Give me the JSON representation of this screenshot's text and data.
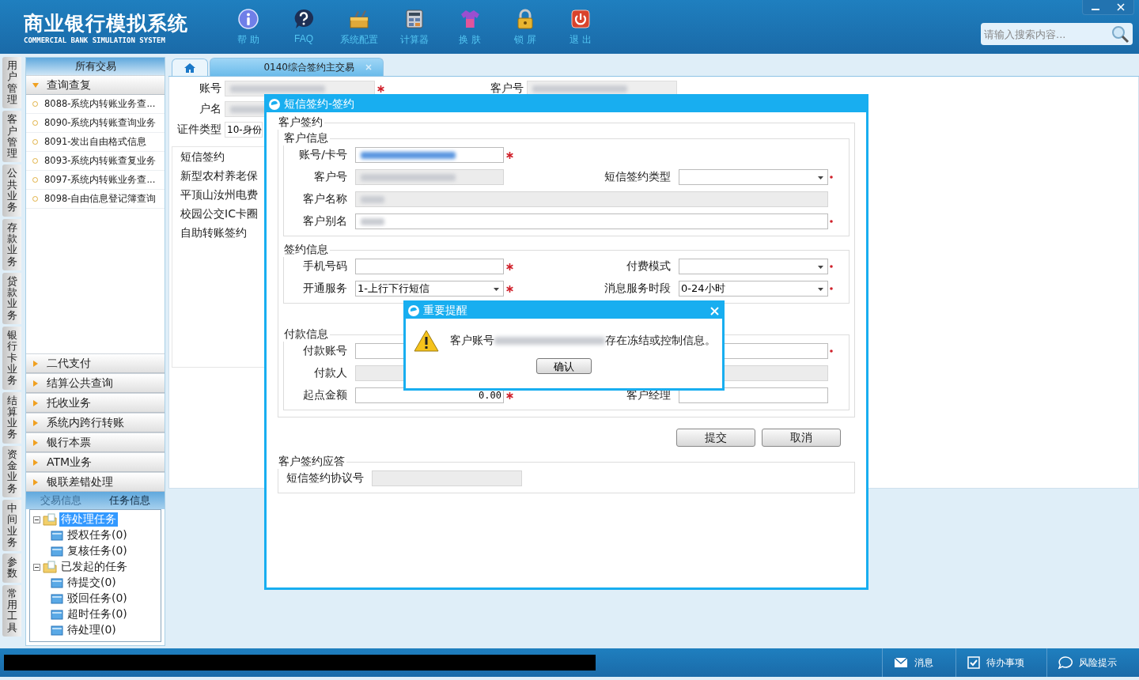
{
  "header": {
    "title": "商业银行模拟系统",
    "subtitle": "COMMERCIAL BANK SIMULATION SYSTEM",
    "toolbar": [
      {
        "kind": "info",
        "label": "帮 助"
      },
      {
        "kind": "faq",
        "label": "FAQ"
      },
      {
        "kind": "config",
        "label": "系统配置"
      },
      {
        "kind": "calculator",
        "label": "计算器"
      },
      {
        "kind": "skin",
        "label": "换 肤"
      },
      {
        "kind": "lock",
        "label": "锁 屏"
      },
      {
        "kind": "exit",
        "label": "退 出"
      }
    ],
    "search": {
      "placeholder": "请输入搜索内容..."
    }
  },
  "side_tabs": [
    "用户管理",
    "客户管理",
    "公共业务",
    "存款业务",
    "贷款业务",
    "银行卡业务",
    "结算业务",
    "资金业务",
    "中间业务",
    "参数",
    "常用工具"
  ],
  "sidebar": {
    "title": "所有交易",
    "groups": [
      {
        "label": "查询查复",
        "expanded": true,
        "items": [
          "8088-系统内转账业务查...",
          "8090-系统内转账查询业务",
          "8091-发出自由格式信息",
          "8093-系统内转账查复业务",
          "8097-系统内转账业务查...",
          "8098-自由信息登记簿查询"
        ]
      },
      {
        "label": "二代支付",
        "expanded": false
      },
      {
        "label": "结算公共查询",
        "expanded": false
      },
      {
        "label": "托收业务",
        "expanded": false
      },
      {
        "label": "系统内跨行转账",
        "expanded": false
      },
      {
        "label": "银行本票",
        "expanded": false
      },
      {
        "label": "ATM业务",
        "expanded": false
      },
      {
        "label": "银联差错处理",
        "expanded": false
      }
    ]
  },
  "task_panel": {
    "tabs": [
      {
        "label": "交易信息",
        "selected": false
      },
      {
        "label": "任务信息",
        "selected": true
      }
    ],
    "tree": [
      {
        "label": "待处理任务",
        "selected": true,
        "expanded": true,
        "children": [
          {
            "label": "授权任务(0)",
            "selected": false
          },
          {
            "label": "复核任务(0)",
            "selected": false
          }
        ]
      },
      {
        "label": "已发起的任务",
        "selected": false,
        "expanded": true,
        "children": [
          {
            "label": "待提交(0)",
            "selected": false
          },
          {
            "label": "驳回任务(0)",
            "selected": false
          },
          {
            "label": "超时任务(0)",
            "selected": false
          },
          {
            "label": "待处理(0)",
            "selected": false
          }
        ]
      }
    ]
  },
  "tabs": [
    {
      "kind": "home",
      "selected": false
    },
    {
      "kind": "page",
      "label": "0140综合签约主交易",
      "selected": true
    }
  ],
  "background_form": {
    "fields": [
      {
        "label": "账号",
        "redacted": true,
        "required": true
      },
      {
        "label": "客户号",
        "redacted": true
      },
      {
        "label": "户名",
        "redacted": true
      },
      {
        "label": "证件类型",
        "value": "10-身份"
      }
    ],
    "sign_types": [
      "短信签约",
      "新型农村养老保",
      "平顶山汝州电费",
      "校园公交IC卡圈",
      "自助转账签约"
    ]
  },
  "dialog": {
    "title": "短信签约-签约",
    "legend": "客户签约",
    "sections": [
      {
        "legend": "客户信息",
        "rows": [
          [
            {
              "label": "账号/卡号",
              "kind": "text",
              "redacted": true,
              "highlighted": true,
              "disabled": false,
              "required": true
            }
          ],
          [
            {
              "label": "客户号",
              "kind": "text",
              "redacted": true,
              "highlighted": false,
              "disabled": true,
              "required": false
            },
            {
              "label": "短信签约类型",
              "kind": "select",
              "disabled": false,
              "required": true
            }
          ],
          [
            {
              "label": "客户名称",
              "kind": "text",
              "wide": true,
              "redacted": true,
              "highlighted": false,
              "disabled": true,
              "required": false
            }
          ],
          [
            {
              "label": "客户别名",
              "kind": "text",
              "wide": true,
              "redacted": true,
              "highlighted": false,
              "disabled": false,
              "required": true
            }
          ]
        ]
      },
      {
        "legend": "签约信息",
        "rows": [
          [
            {
              "label": "手机号码",
              "kind": "text",
              "disabled": false,
              "required": true
            },
            {
              "label": "付费模式",
              "kind": "select",
              "disabled": false,
              "required": true
            }
          ],
          [
            {
              "label": "开通服务",
              "kind": "select",
              "value": "1-上行下行短信",
              "disabled": false,
              "required": true
            },
            {
              "label": "消息服务时段",
              "kind": "select",
              "value": "0-24小时",
              "disabled": false,
              "required": true
            }
          ]
        ]
      },
      {
        "legend": "付款信息",
        "rows": [
          [
            {
              "label": "付款账号",
              "kind": "text",
              "wide": true,
              "disabled": false,
              "required": true
            }
          ],
          [
            {
              "label": "付款人",
              "kind": "text",
              "wide": true,
              "disabled": true,
              "required": false
            }
          ],
          [
            {
              "label": "起点金额",
              "kind": "amount",
              "value": "0.00",
              "disabled": false,
              "required": true
            },
            {
              "label": "客户经理",
              "kind": "text",
              "disabled": false,
              "required": false
            }
          ]
        ]
      }
    ],
    "buttons": [
      "提交",
      "取消"
    ],
    "response": {
      "legend": "客户签约应答",
      "fields": [
        {
          "label": "短信签约协议号",
          "disabled": true,
          "required": false
        }
      ]
    }
  },
  "alert": {
    "title": "重要提醒",
    "message_before": "客户账号",
    "account_redacted": true,
    "message_after": "存在冻结或控制信息。",
    "button": "确认"
  },
  "status_bar": {
    "redacted": true,
    "items": [
      {
        "kind": "message",
        "label": "消息"
      },
      {
        "kind": "todo",
        "label": "待办事项"
      },
      {
        "kind": "risk",
        "label": "风险提示"
      }
    ]
  }
}
